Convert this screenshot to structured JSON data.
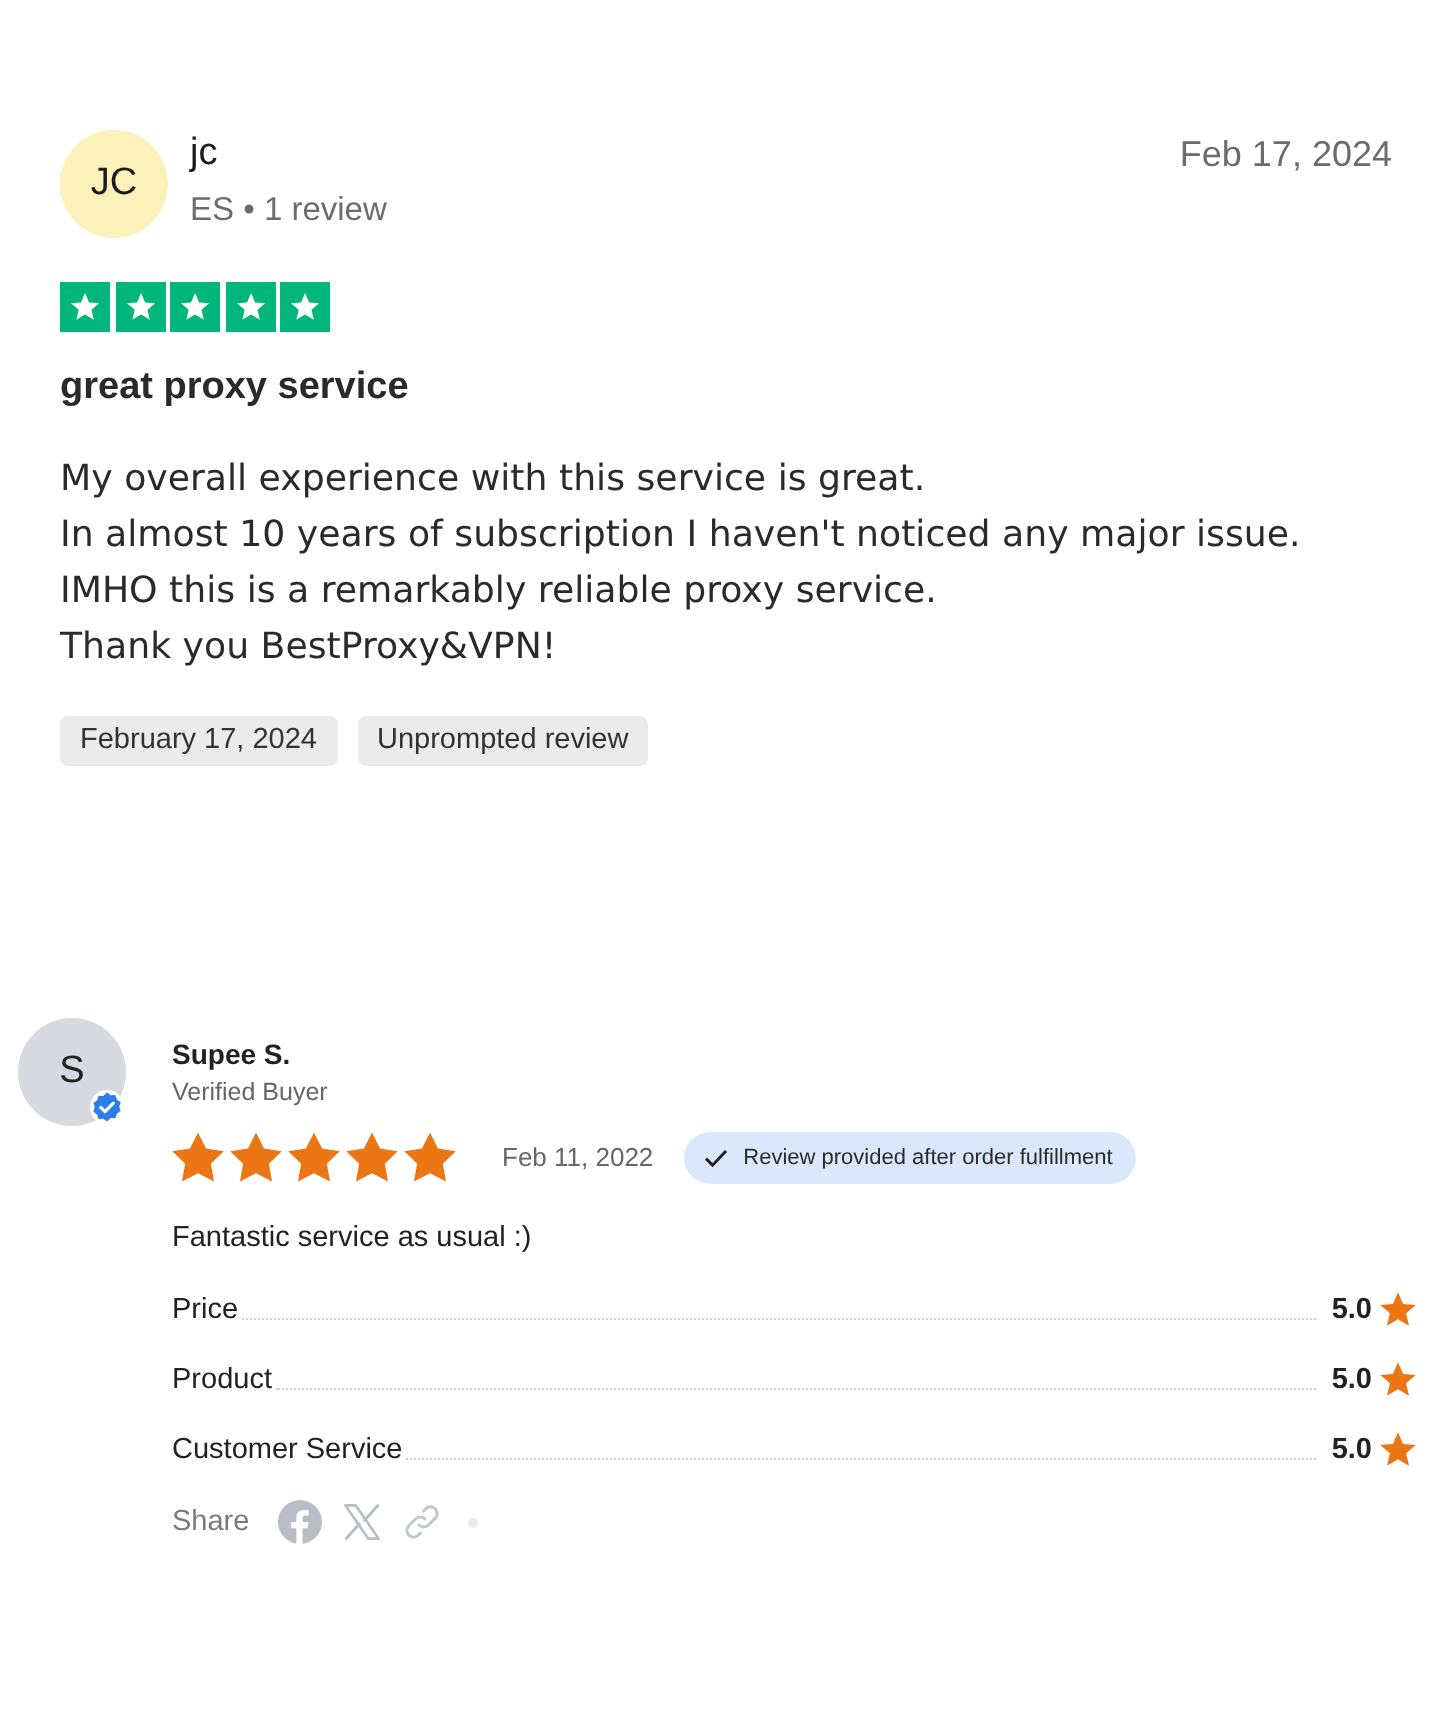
{
  "reviews": [
    {
      "kind": "trustpilot",
      "avatar": {
        "initials": "JC"
      },
      "author": "jc",
      "meta": "ES • 1 review",
      "date": "Feb 17, 2024",
      "stars": 5,
      "title": "great proxy service",
      "body": "My overall experience with this service is great.\nIn almost 10 years of subscription I haven't noticed any major issue.\nIMHO this is a remarkably reliable proxy service.\nThank you BestProxy&VPN!",
      "tags": [
        "February 17, 2024",
        "Unprompted review"
      ]
    },
    {
      "kind": "shop",
      "avatar": {
        "initials": "S",
        "verified": true
      },
      "author": "Supee S.",
      "badge": "Verified Buyer",
      "stars": 5,
      "date": "Feb 11, 2022",
      "pill": "Review provided after order fulfillment",
      "body": "Fantastic service as usual :)",
      "ratings": [
        {
          "label": "Price",
          "score": "5.0"
        },
        {
          "label": "Product",
          "score": "5.0"
        },
        {
          "label": "Customer Service",
          "score": "5.0"
        }
      ],
      "share": {
        "label": "Share"
      }
    }
  ]
}
